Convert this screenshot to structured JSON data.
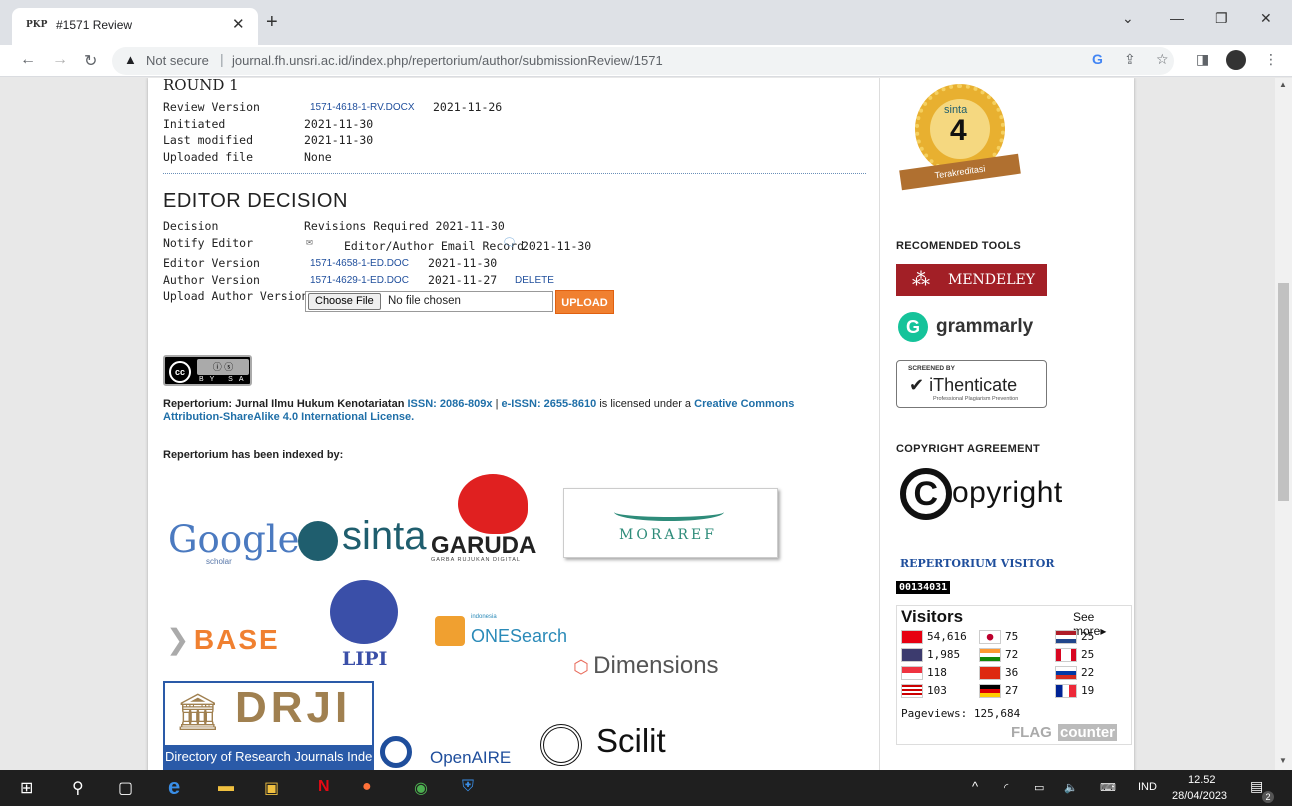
{
  "browser": {
    "tab_icon_text": "PKP",
    "tab_title": "#1571 Review",
    "security_label": "Not secure",
    "url": "journal.fh.unsri.ac.id/index.php/repertorium/author/submissionReview/1571"
  },
  "review": {
    "round_title": "ROUND 1",
    "rows": [
      {
        "label": "Review Version",
        "link": "1571-4618-1-RV.DOCX",
        "value": "2021-11-26"
      },
      {
        "label": "Initiated",
        "value": "2021-11-30"
      },
      {
        "label": "Last modified",
        "value": "2021-11-30"
      },
      {
        "label": "Uploaded file",
        "value": "None"
      }
    ]
  },
  "editor_decision": {
    "heading": "EDITOR DECISION",
    "decision_label": "Decision",
    "decision_value": "Revisions Required 2021-11-30",
    "notify_label": "Notify Editor",
    "notify_text": "Editor/Author Email Record",
    "notify_date": "2021-11-30",
    "editor_version_label": "Editor Version",
    "editor_version_link": "1571-4658-1-ED.DOC",
    "editor_version_date": "2021-11-30",
    "author_version_label": "Author Version",
    "author_version_link": "1571-4629-1-ED.DOC",
    "author_version_date": "2021-11-27",
    "delete_label": "DELETE",
    "upload_label": "Upload Author Version",
    "choose_file": "Choose File",
    "no_file": "No file chosen",
    "upload_button": "UPLOAD"
  },
  "license": {
    "cc_by": "BY",
    "cc_sa": "SA",
    "journal": "Repertorium: Jurnal Ilmu Hukum Kenotariatan",
    "issn": "ISSN: 2086-809x",
    "sep": "|",
    "eissn": "e-ISSN: 2655-8610",
    "mid": "is licensed under a",
    "cc_link": "Creative Commons Attribution-ShareAlike 4.0 International License."
  },
  "indexed": {
    "heading": "Repertorium has been indexed by:",
    "google": "Google",
    "google_sub": "scholar",
    "sinta": "sinta",
    "garuda": "GARUDA",
    "garuda_sub": "GARBA RUJUKAN DIGITAL",
    "moraref": "MORAREF",
    "base": "BASE",
    "lipi": "LIPI",
    "onesearch_top": "indonesia",
    "onesearch": "ONESearch",
    "dimensions": "Dimensions",
    "drji": "DRJI",
    "drji_sub": "Directory of Research Journals Indexing",
    "openaire": "OpenAIRE",
    "scilit": "Scilit"
  },
  "sidebar": {
    "sinta_badge_brand": "sinta",
    "sinta_badge_num": "4",
    "sinta_badge_ribbon": "Terakreditasi",
    "tools_heading": "RECOMENDED TOOLS",
    "mendeley": "MENDELEY",
    "grammarly": "grammarly",
    "ithenticate_top": "SCREENED BY",
    "ithenticate": "iThenticate",
    "ithenticate_sub": "Professional Plagiarism Prevention",
    "copyright_heading": "COPYRIGHT AGREEMENT",
    "copyright": "opyright",
    "visitor_heading": "REPERTORIUM VISITOR",
    "counter": "00134031",
    "flag_title": "Visitors",
    "see_more": "See more",
    "flags": [
      {
        "count": "54,616",
        "color": "#e70011"
      },
      {
        "count": "75",
        "color": "#bc002d"
      },
      {
        "count": "25",
        "color": "#21468b"
      },
      {
        "count": "1,985",
        "color": "#3c3b6e"
      },
      {
        "count": "72",
        "color": "#ff9933"
      },
      {
        "count": "25",
        "color": "#d80621"
      },
      {
        "count": "118",
        "color": "#ef3340"
      },
      {
        "count": "36",
        "color": "#de2910"
      },
      {
        "count": "22",
        "color": "#0039a6"
      },
      {
        "count": "103",
        "color": "#010066"
      },
      {
        "count": "27",
        "color": "#dd0000"
      },
      {
        "count": "19",
        "color": "#002395"
      }
    ],
    "pageviews": "Pageviews: 125,684",
    "flag_counter_a": "FLAG",
    "flag_counter_b": "counter"
  },
  "taskbar": {
    "lang": "IND",
    "time": "12.52",
    "date": "28/04/2023",
    "notif": "2"
  }
}
